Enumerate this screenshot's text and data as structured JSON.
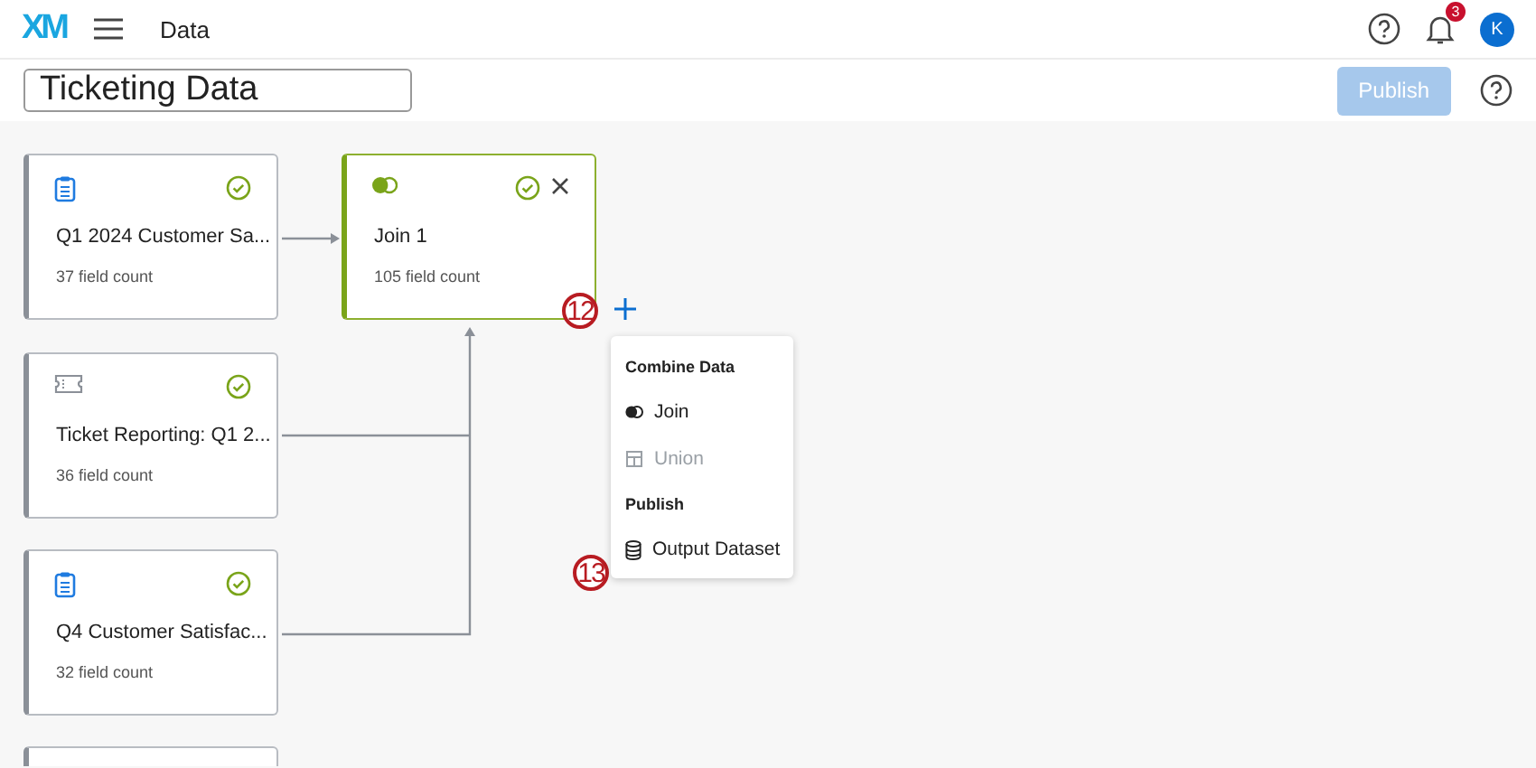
{
  "header": {
    "logo": "XM",
    "section": "Data",
    "notifications": "3",
    "avatar": "K"
  },
  "toolbar": {
    "title": "Ticketing Data",
    "publish": {
      "label": "Publish",
      "disabled": true
    }
  },
  "sources": [
    {
      "kind": "survey",
      "name": "Q1 2024 Customer Sa...",
      "field_count": "37 field count",
      "valid": true
    },
    {
      "kind": "ticket",
      "name": "Ticket Reporting: Q1 2...",
      "field_count": "36 field count",
      "valid": true
    },
    {
      "kind": "survey",
      "name": "Q4 Customer Satisfac...",
      "field_count": "32 field count",
      "valid": true
    }
  ],
  "join": {
    "name": "Join 1",
    "field_count": "105 field count",
    "valid": true,
    "selected": true
  },
  "callouts": [
    "12",
    "13"
  ],
  "menu": [
    {
      "heading": "Combine Data",
      "items": [
        {
          "label": "Join",
          "kind": "join",
          "disabled": false
        },
        {
          "label": "Union",
          "kind": "union",
          "disabled": true
        }
      ]
    },
    {
      "heading": "Publish",
      "items": [
        {
          "label": "Output Dataset",
          "kind": "output",
          "disabled": false
        }
      ]
    }
  ]
}
